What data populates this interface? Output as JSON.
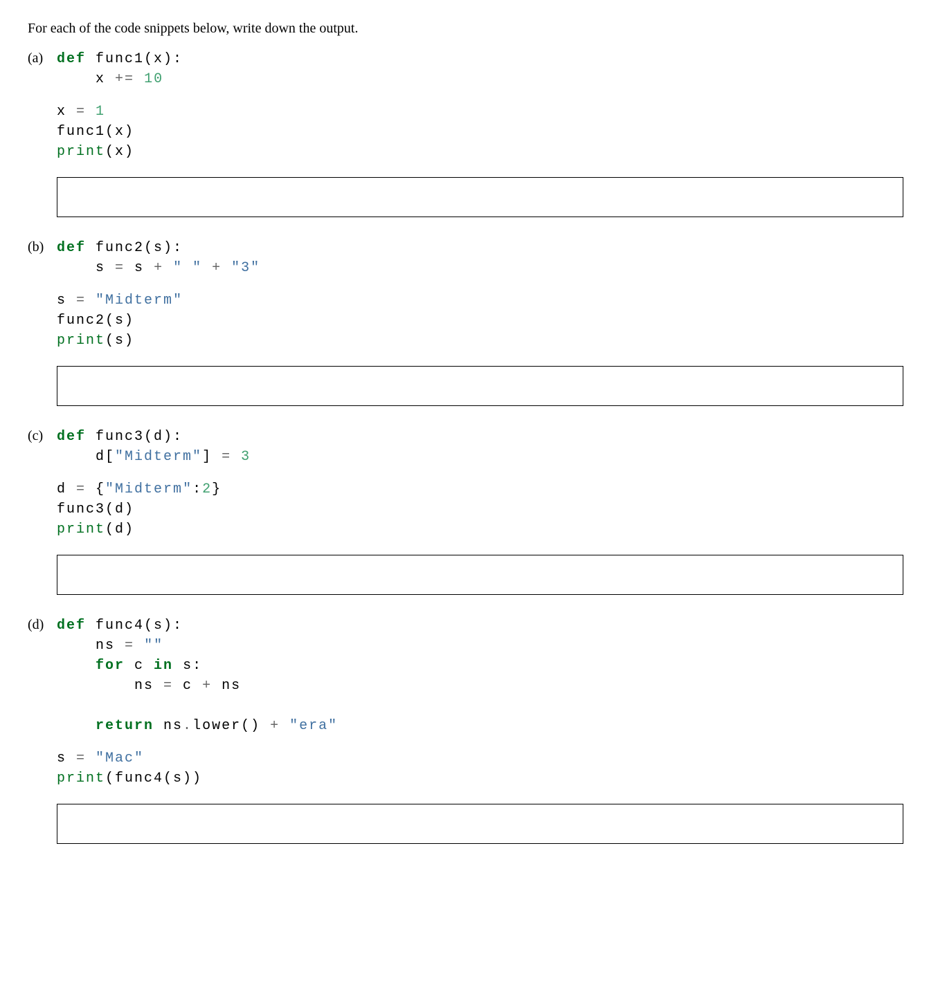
{
  "intro": "For each of the code snippets below, write down the output.",
  "questions": {
    "a": {
      "label": "(a)",
      "code1": {
        "def": "def",
        "func": "func1",
        "param": "(x):",
        "l2a": "x ",
        "l2op": "+=",
        "l2b": " ",
        "l2num": "10"
      },
      "code2": {
        "l1a": "x ",
        "l1op": "=",
        "l1b": " ",
        "l1num": "1",
        "l2": "func1(x)",
        "l3print": "print",
        "l3b": "(x)"
      }
    },
    "b": {
      "label": "(b)",
      "code1": {
        "def": "def",
        "func": "func2",
        "param": "(s):",
        "l2a": "s ",
        "l2eq": "=",
        "l2b": " s ",
        "l2plus1": "+",
        "l2c": " ",
        "l2str1": "\" \"",
        "l2d": " ",
        "l2plus2": "+",
        "l2e": " ",
        "l2str2": "\"3\""
      },
      "code2": {
        "l1a": "s ",
        "l1eq": "=",
        "l1b": " ",
        "l1str": "\"Midterm\"",
        "l2": "func2(s)",
        "l3print": "print",
        "l3b": "(s)"
      }
    },
    "c": {
      "label": "(c)",
      "code1": {
        "def": "def",
        "func": "func3",
        "param": "(d):",
        "l2a": "d[",
        "l2str": "\"Midterm\"",
        "l2b": "] ",
        "l2eq": "=",
        "l2c": " ",
        "l2num": "3"
      },
      "code2": {
        "l1a": "d ",
        "l1eq": "=",
        "l1b": " {",
        "l1str": "\"Midterm\"",
        "l1c": ":",
        "l1num": "2",
        "l1d": "}",
        "l2": "func3(d)",
        "l3print": "print",
        "l3b": "(d)"
      }
    },
    "d": {
      "label": "(d)",
      "code1": {
        "def": "def",
        "func": "func4",
        "param": "(s):",
        "l2a": "ns ",
        "l2eq": "=",
        "l2b": " ",
        "l2str": "\"\"",
        "l3for": "for",
        "l3a": " c ",
        "l3in": "in",
        "l3b": " s:",
        "l4a": "ns ",
        "l4eq": "=",
        "l4b": " c ",
        "l4plus": "+",
        "l4c": " ns",
        "l5ret": "return",
        "l5a": " ns",
        "l5dot": ".",
        "l5low": "lower() ",
        "l5plus": "+",
        "l5b": " ",
        "l5str": "\"era\""
      },
      "code2": {
        "l1a": "s ",
        "l1eq": "=",
        "l1b": " ",
        "l1str": "\"Mac\"",
        "l2print": "print",
        "l2b": "(func4(s))"
      }
    }
  }
}
